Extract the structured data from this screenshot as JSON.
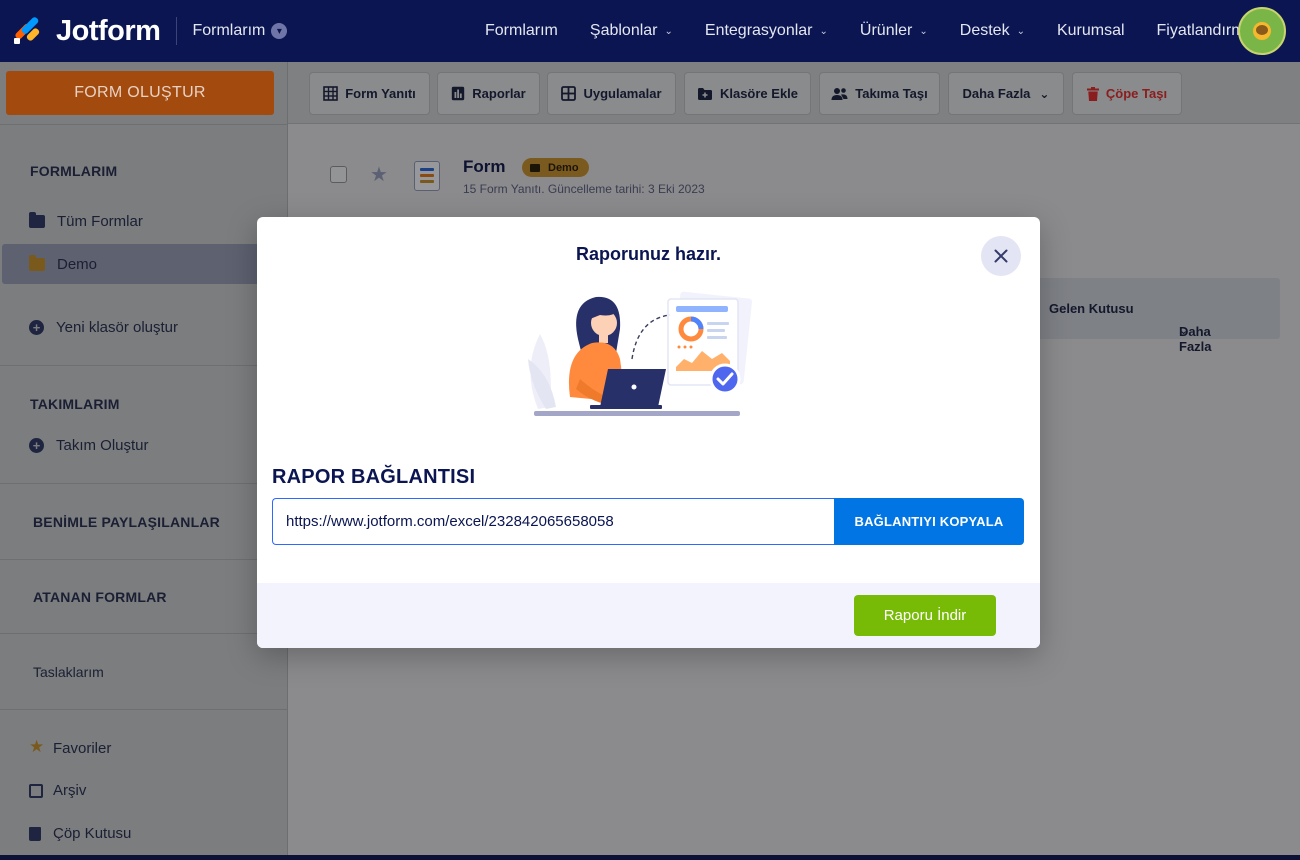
{
  "brand": {
    "name": "Jotform"
  },
  "topnav": {
    "workspace_label": "Formlarım",
    "items": [
      {
        "label": "Formlarım",
        "caret": false
      },
      {
        "label": "Şablonlar",
        "caret": true
      },
      {
        "label": "Entegrasyonlar",
        "caret": true
      },
      {
        "label": "Ürünler",
        "caret": true
      },
      {
        "label": "Destek",
        "caret": true
      },
      {
        "label": "Kurumsal",
        "caret": false
      },
      {
        "label": "Fiyatlandırma",
        "caret": false
      }
    ]
  },
  "sidebar": {
    "create_label": "FORM OLUŞTUR",
    "myforms_heading": "FORMLARIM",
    "all_forms": "Tüm Formlar",
    "demo_folder": "Demo",
    "new_folder": "Yeni klasör oluştur",
    "teams_heading": "TAKIMLARIM",
    "create_team": "Takım Oluştur",
    "shared_heading": "BENİMLE PAYLAŞILANLAR",
    "assigned_heading": "ATANAN FORMLAR",
    "drafts": "Taslaklarım",
    "favorites": "Favoriler",
    "archive": "Arşiv",
    "trash": "Çöp Kutusu"
  },
  "toolbar": {
    "submissions": "Form Yanıtı",
    "reports": "Raporlar",
    "apps": "Uygulamalar",
    "move_folder": "Klasöre Ekle",
    "move_team": "Takıma Taşı",
    "more": "Daha Fazla",
    "trash": "Çöpe Taşı"
  },
  "form_item": {
    "title": "Form",
    "tag": "Demo",
    "meta": "15 Form Yanıtı. Güncelleme tarihi: 3 Eki 2023",
    "inbox": "Gelen Kutusu",
    "more": "Daha Fazla"
  },
  "modal": {
    "title": "Raporunuz hazır.",
    "section_label": "RAPOR BAĞLANTISI",
    "link": "https://www.jotform.com/excel/232842065658058",
    "copy_label": "BAĞLANTIYI KOPYALA",
    "download_label": "Raporu İndir"
  },
  "colors": {
    "nav_bg": "#0a1551",
    "accent_orange": "#ff6100",
    "copy_blue": "#0075e3",
    "download_green": "#78bb07"
  }
}
